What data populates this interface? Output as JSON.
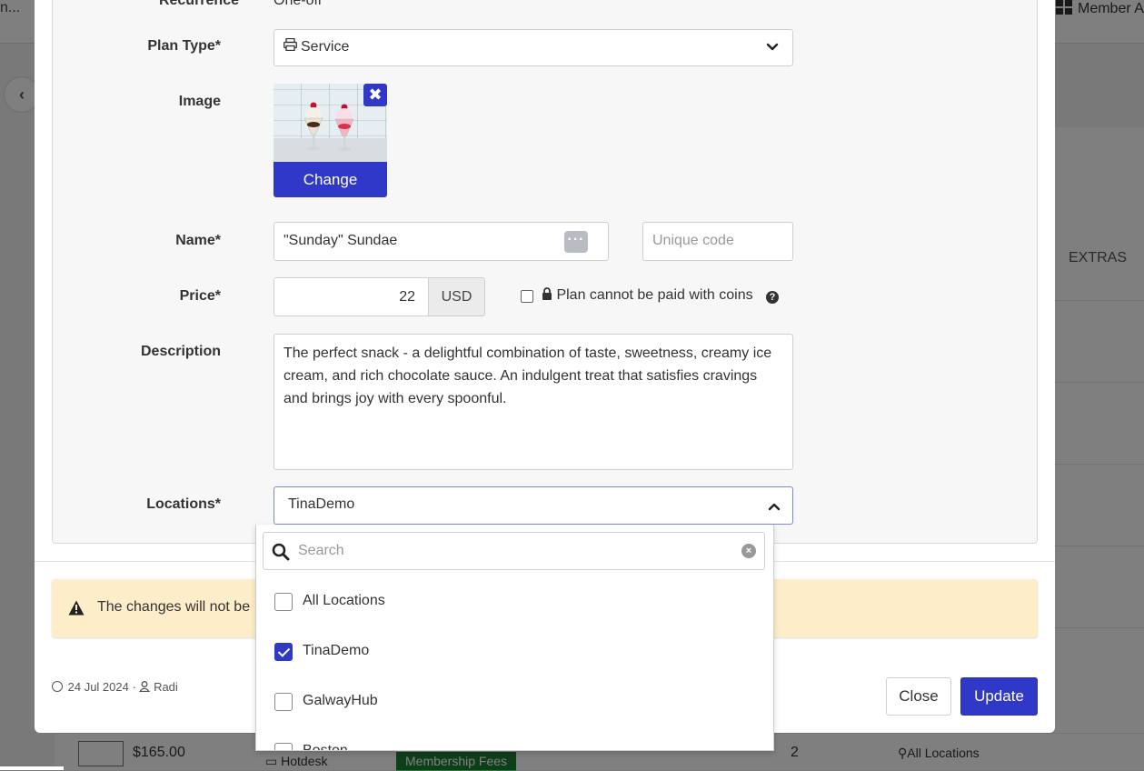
{
  "background": {
    "crumb": "n...",
    "member_label": "Member A",
    "extras_label": "EXTRAS",
    "row": {
      "price": "$165.00",
      "product": "Hotdesk",
      "fees": "Membership Fees",
      "count": "2",
      "locations": "All Locations"
    }
  },
  "form": {
    "recurrence": {
      "label": "Recurrence",
      "value": "One-off"
    },
    "plan_type": {
      "label": "Plan Type*",
      "value": "Service",
      "icon": "printer-icon"
    },
    "image": {
      "label": "Image",
      "change_label": "Change",
      "remove_icon": "close-icon"
    },
    "name": {
      "label": "Name*",
      "value": "\"Sunday\" Sundae",
      "code_placeholder": "Unique code"
    },
    "price": {
      "label": "Price*",
      "value": "22",
      "currency": "USD",
      "coins_label": "Plan cannot be paid with coins"
    },
    "description": {
      "label": "Description",
      "value": "The perfect snack - a delightful combination of taste, sweetness, creamy ice cream, and rich chocolate sauce. An indulgent treat that satisfies cravings and brings joy with every spoonful."
    },
    "locations": {
      "label": "Locations*",
      "value": "TinaDemo",
      "search_placeholder": "Search",
      "options": [
        {
          "label": "All Locations",
          "checked": false
        },
        {
          "label": "TinaDemo",
          "checked": true
        },
        {
          "label": "GalwayHub",
          "checked": false
        },
        {
          "label": "Boston",
          "checked": false
        }
      ]
    }
  },
  "warning": {
    "text": "The changes will not be"
  },
  "footer": {
    "date": "24 Jul 2024",
    "user": "Radi",
    "close_label": "Close",
    "update_label": "Update"
  },
  "colors": {
    "accent": "#3038c7",
    "warning_bg": "#feedc9"
  }
}
